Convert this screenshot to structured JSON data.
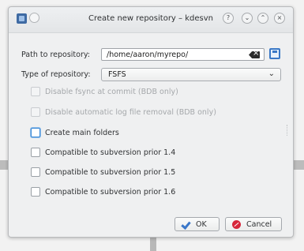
{
  "window": {
    "title": "Create new repository – kdesvn",
    "buttons": {
      "help": "?",
      "minimize": "⌄",
      "maximize": "⌃",
      "close": "×"
    }
  },
  "form": {
    "path_label": "Path to repository:",
    "path_value": "/home/aaron/myrepo/",
    "type_label": "Type of repository:",
    "type_value": "FSFS"
  },
  "options": [
    {
      "label": "Disable fsync at commit (BDB only)",
      "checked": false,
      "enabled": false
    },
    {
      "label": "Disable automatic log file removal (BDB only)",
      "checked": false,
      "enabled": false
    },
    {
      "label": "Create main folders",
      "checked": false,
      "enabled": true,
      "focused": true
    },
    {
      "label": "Compatible to subversion prior 1.4",
      "checked": false,
      "enabled": true
    },
    {
      "label": "Compatible to subversion prior 1.5",
      "checked": false,
      "enabled": true
    },
    {
      "label": "Compatible to subversion prior 1.6",
      "checked": false,
      "enabled": true
    }
  ],
  "actions": {
    "ok_label": "OK",
    "cancel_label": "Cancel"
  },
  "colors": {
    "accent": "#3a77c9",
    "cancel": "#d7263b"
  }
}
